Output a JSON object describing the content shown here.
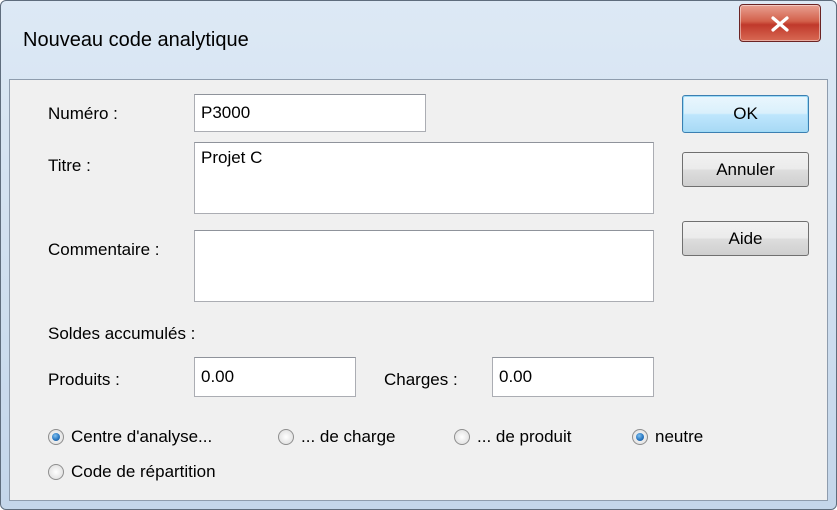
{
  "window": {
    "title": "Nouveau code analytique"
  },
  "form": {
    "numero": {
      "label": "Numéro :",
      "value": "P3000"
    },
    "titre": {
      "label": "Titre :",
      "value": "Projet C"
    },
    "commentaire": {
      "label": "Commentaire :",
      "value": ""
    },
    "soldes_label": "Soldes accumulés :",
    "produits": {
      "label": "Produits :",
      "value": "0.00"
    },
    "charges": {
      "label": "Charges :",
      "value": "0.00"
    }
  },
  "buttons": {
    "ok": "OK",
    "cancel": "Annuler",
    "help": "Aide"
  },
  "radios": {
    "centre": {
      "label": "Centre d'analyse...",
      "checked": true
    },
    "charge": {
      "label": "... de charge",
      "checked": false
    },
    "produit": {
      "label": "... de produit",
      "checked": false
    },
    "neutre": {
      "label": "neutre",
      "checked": true
    },
    "repartition": {
      "label": "Code de répartition",
      "checked": false
    }
  },
  "colors": {
    "title_gradient_top": "#dde9f5",
    "client_bg": "#f0f0f0",
    "close_red": "#c0392b",
    "radio_blue": "#2a78c2"
  }
}
